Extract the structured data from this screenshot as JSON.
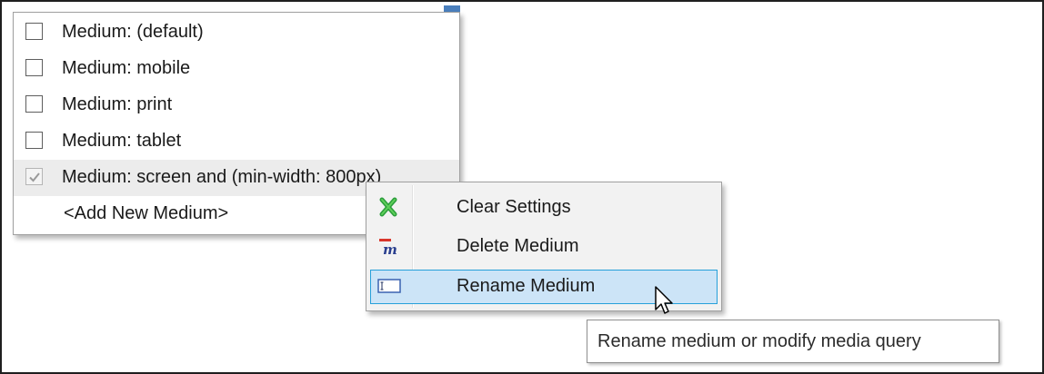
{
  "media_menu": {
    "items": [
      {
        "label": "Medium: (default)",
        "checked": false
      },
      {
        "label": "Medium: mobile",
        "checked": false
      },
      {
        "label": "Medium: print",
        "checked": false
      },
      {
        "label": "Medium: tablet",
        "checked": false
      },
      {
        "label": "Medium: screen and (min-width: 800px)",
        "checked": true
      }
    ],
    "add_new_label": "<Add New Medium>"
  },
  "context_menu": {
    "items": [
      {
        "label": "Clear Settings",
        "icon": "clear-x-icon"
      },
      {
        "label": "Delete Medium",
        "icon": "delete-medium-icon"
      },
      {
        "label": "Rename Medium",
        "icon": "rename-field-icon",
        "highlighted": true
      }
    ]
  },
  "tooltip": {
    "text": "Rename medium or modify media query"
  },
  "colors": {
    "highlight_fill": "#cce4f7",
    "highlight_border": "#26a0da",
    "clear_icon_green": "#2a9d3a",
    "delete_icon_red": "#d9362b",
    "rename_icon_blue": "#3a62b0"
  }
}
